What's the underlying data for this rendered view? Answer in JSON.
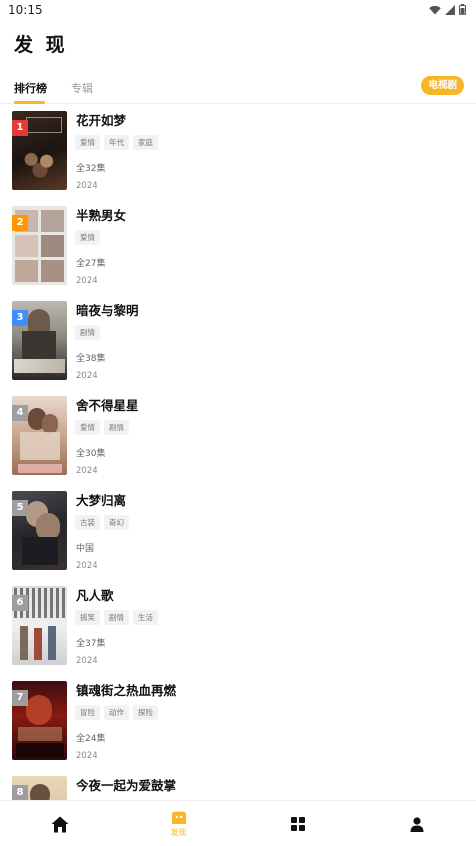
{
  "status_bar": {
    "time": "10:15"
  },
  "page_title": "发 现",
  "tabs": [
    {
      "label": "排行榜",
      "active": true
    },
    {
      "label": "专辑",
      "active": false
    }
  ],
  "category_pill": "电视剧",
  "items": [
    {
      "rank": "1",
      "title": "花开如梦",
      "tags": [
        "爱情",
        "年代",
        "家庭"
      ],
      "meta": "全32集",
      "year": "2024",
      "rank_color": "#e53935"
    },
    {
      "rank": "2",
      "title": "半熟男女",
      "tags": [
        "爱情"
      ],
      "meta": "全27集",
      "year": "2024",
      "rank_color": "#ff9800"
    },
    {
      "rank": "3",
      "title": "暗夜与黎明",
      "tags": [
        "剧情"
      ],
      "meta": "全38集",
      "year": "2024",
      "rank_color": "#3f8efc"
    },
    {
      "rank": "4",
      "title": "舍不得星星",
      "tags": [
        "爱情",
        "剧情"
      ],
      "meta": "全30集",
      "year": "2024",
      "rank_color": "#9e9e9e"
    },
    {
      "rank": "5",
      "title": "大梦归离",
      "tags": [
        "古装",
        "奇幻"
      ],
      "meta": "中国",
      "year": "2024",
      "rank_color": "#9e9e9e"
    },
    {
      "rank": "6",
      "title": "凡人歌",
      "tags": [
        "搞笑",
        "剧情",
        "生活"
      ],
      "meta": "全37集",
      "year": "2024",
      "rank_color": "#9e9e9e"
    },
    {
      "rank": "7",
      "title": "镇魂街之热血再燃",
      "tags": [
        "冒险",
        "动作",
        "探险"
      ],
      "meta": "全24集",
      "year": "2024",
      "rank_color": "#9e9e9e"
    },
    {
      "rank": "8",
      "title": "今夜一起为爱鼓掌",
      "tags": [],
      "meta": "",
      "year": "",
      "rank_color": "#9e9e9e"
    }
  ],
  "bottom_nav": [
    {
      "icon": "home-icon",
      "label": ""
    },
    {
      "icon": "discover-icon",
      "label": "发现"
    },
    {
      "icon": "grid-icon",
      "label": ""
    },
    {
      "icon": "user-icon",
      "label": ""
    }
  ],
  "colors": {
    "accent": "#f7b528"
  }
}
